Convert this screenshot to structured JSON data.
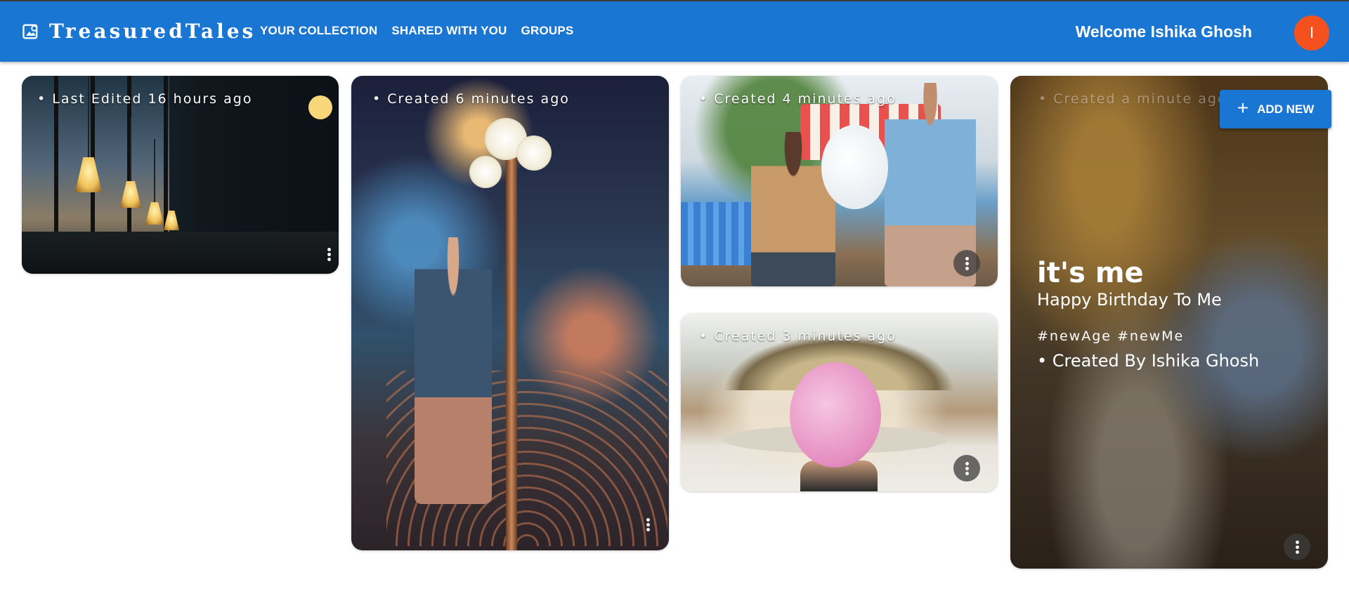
{
  "brand": {
    "name": "TreasuredTales",
    "icon": "photo-album-icon"
  },
  "nav": [
    {
      "label": "YOUR COLLECTION"
    },
    {
      "label": "SHARED WITH YOU"
    },
    {
      "label": "GROUPS"
    }
  ],
  "user": {
    "welcome": "Welcome Ishika Ghosh",
    "avatar_initial": "I",
    "avatar_color": "#f4511e"
  },
  "colors": {
    "appbar": "#1976d2",
    "accent": "#1976d2"
  },
  "add_button": {
    "label": "ADD NEW",
    "icon": "plus-icon"
  },
  "cards": [
    {
      "meta": "• Last Edited 16 hours ago"
    },
    {
      "meta": "• Created 6 minutes ago"
    },
    {
      "meta": "• Created 4 minutes ago"
    },
    {
      "meta": "• Created 3 minutes ago"
    },
    {
      "meta": "• Created a minute ago",
      "title": "it's me",
      "subtitle": "Happy Birthday To Me",
      "tags": "#newAge #newMe",
      "author": "• Created By Ishika Ghosh"
    }
  ]
}
